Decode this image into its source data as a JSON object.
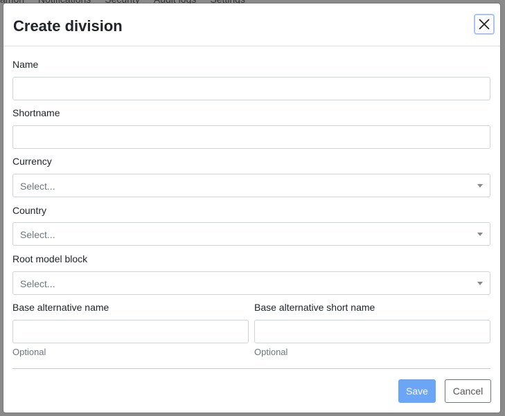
{
  "background_nav": [
    "amon",
    "Notifications",
    "Security",
    "Audit logs",
    "Settings"
  ],
  "modal": {
    "title": "Create division",
    "close_icon": "close-icon",
    "fields": {
      "name": {
        "label": "Name",
        "value": ""
      },
      "shortname": {
        "label": "Shortname",
        "value": ""
      },
      "currency": {
        "label": "Currency",
        "placeholder": "Select..."
      },
      "country": {
        "label": "Country",
        "placeholder": "Select..."
      },
      "root_model_block": {
        "label": "Root model block",
        "placeholder": "Select..."
      },
      "base_alt_name": {
        "label": "Base alternative name",
        "help": "Optional",
        "value": ""
      },
      "base_alt_short_name": {
        "label": "Base alternative short name",
        "help": "Optional",
        "value": ""
      }
    },
    "buttons": {
      "save": "Save",
      "cancel": "Cancel"
    }
  },
  "colors": {
    "primary": "#6ba6f6",
    "border": "#ced4da",
    "focus_ring": "#a9c4ef"
  }
}
